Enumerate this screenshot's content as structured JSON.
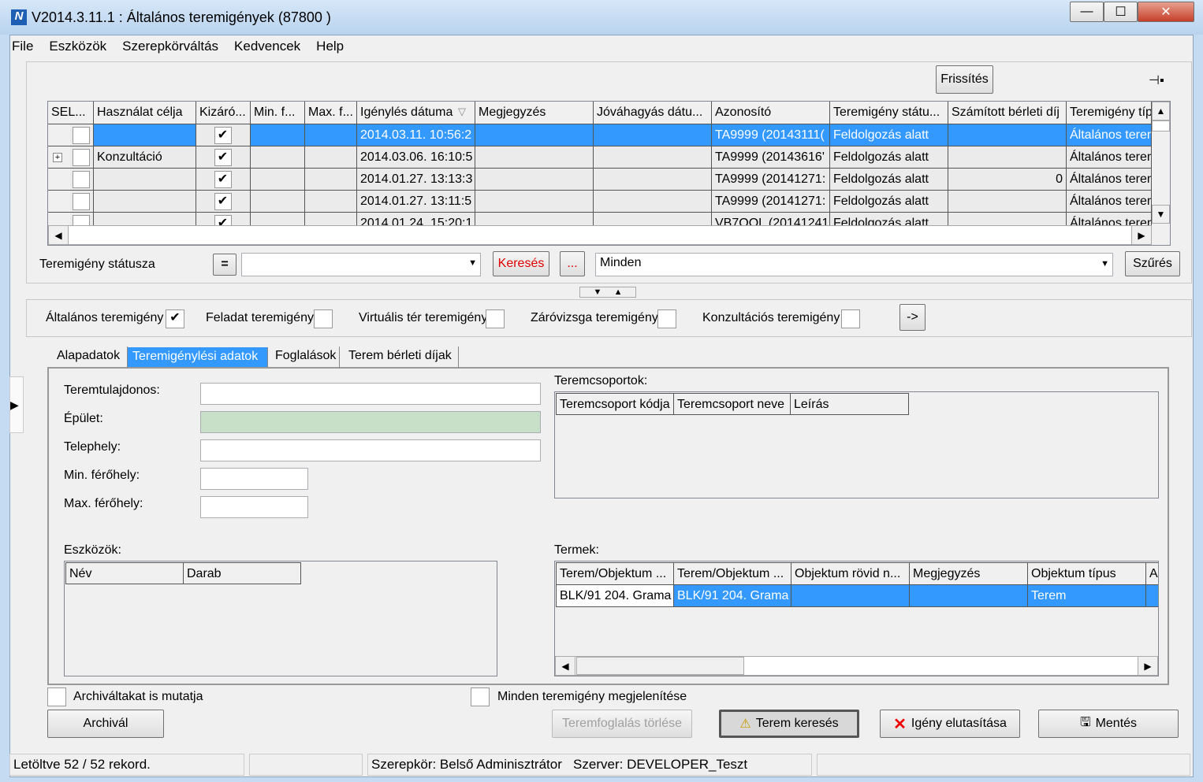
{
  "window": {
    "title": "V2014.3.11.1 : Általános teremigények (87800  )",
    "minimize": "—",
    "maximize": "☐",
    "close": "✕"
  },
  "menu": [
    "File",
    "Eszközök",
    "Szerepkörváltás",
    "Kedvencek",
    "Help"
  ],
  "toolbar": {
    "refresh": "Frissítés",
    "pin_icon": "pin-icon"
  },
  "main_grid": {
    "columns": [
      "SEL...",
      "Használat célja",
      "Kizáró...",
      "Min. f...",
      "Max. f...",
      "Igénylés dátuma",
      "Megjegyzés",
      "Jóváhagyás dátu...",
      "Azonosító",
      "Teremigény státu...",
      "Számított bérleti díj",
      "Teremigény típ"
    ],
    "sort_indicator": "▽",
    "rows": [
      {
        "selected": true,
        "expand": "",
        "sel": "",
        "cel": "",
        "kizaro": "✔",
        "min": "",
        "max": "",
        "datum": "2014.03.11. 10:56:2",
        "megj": "",
        "jovahagyas": "",
        "azon": "TA9999 (20143111(",
        "statusz": "Feldolgozás alatt",
        "dij": "",
        "tipus": "Általános terem"
      },
      {
        "selected": false,
        "expand": "+",
        "sel": "",
        "cel": "Konzultáció",
        "kizaro": "✔",
        "min": "",
        "max": "",
        "datum": "2014.03.06. 16:10:5",
        "megj": "",
        "jovahagyas": "",
        "azon": "TA9999 (20143616'",
        "statusz": "Feldolgozás alatt",
        "dij": "",
        "tipus": "Általános terem"
      },
      {
        "selected": false,
        "expand": "",
        "sel": "",
        "cel": "",
        "kizaro": "✔",
        "min": "",
        "max": "",
        "datum": "2014.01.27. 13:13:3",
        "megj": "",
        "jovahagyas": "",
        "azon": "TA9999 (20141271:",
        "statusz": "Feldolgozás alatt",
        "dij": "0",
        "tipus": "Általános terem"
      },
      {
        "selected": false,
        "expand": "",
        "sel": "",
        "cel": "",
        "kizaro": "✔",
        "min": "",
        "max": "",
        "datum": "2014.01.27. 13:11:5",
        "megj": "",
        "jovahagyas": "",
        "azon": "TA9999 (20141271:",
        "statusz": "Feldolgozás alatt",
        "dij": "",
        "tipus": "Általános terem"
      },
      {
        "selected": false,
        "expand": "",
        "sel": "",
        "cel": "",
        "kizaro": "✔",
        "min": "",
        "max": "",
        "datum": "2014.01.24. 15:20:1",
        "megj": "",
        "jovahagyas": "",
        "azon": "VB7OOL (20141241",
        "statusz": "Feldolgozás alatt",
        "dij": "",
        "tipus": "Általános terem"
      }
    ]
  },
  "filter": {
    "label": "Teremigény státusza",
    "equals": "=",
    "status_value": "",
    "search": "Keresés",
    "ellipsis": "...",
    "combo_value": "Minden",
    "filter_button": "Szűrés"
  },
  "types": [
    {
      "label": "Általános teremigény",
      "checked": true
    },
    {
      "label": "Feladat teremigény",
      "checked": false
    },
    {
      "label": "Virtuális tér teremigény",
      "checked": false
    },
    {
      "label": "Záróvizsga teremigény",
      "checked": false
    },
    {
      "label": "Konzultációs teremigény",
      "checked": false
    }
  ],
  "types_go": "->",
  "tabs": [
    {
      "label": "Alapadatok",
      "active": false
    },
    {
      "label": "Teremigénylési adatok",
      "active": true
    },
    {
      "label": "Foglalások",
      "active": false
    },
    {
      "label": "Terem bérleti díjak",
      "active": false
    }
  ],
  "form": {
    "teremtulajdonos": "Teremtulajdonos:",
    "epulet": "Épület:",
    "telephely": "Telephely:",
    "min": "Min. férőhely:",
    "max": "Max. férőhely:"
  },
  "teremcsoportok": {
    "label": "Teremcsoportok:",
    "columns": [
      "Teremcsoport kódja",
      "Teremcsoport neve",
      "Leírás"
    ]
  },
  "eszkozok": {
    "label": "Eszközök:",
    "columns": [
      "Név",
      "Darab"
    ]
  },
  "termek": {
    "label": "Termek:",
    "columns": [
      "Terem/Objektum ...",
      "Terem/Objektum ...",
      "Objektum rövid n...",
      "Megjegyzés",
      "Objektum típus",
      "A"
    ],
    "rows": [
      [
        "BLK/91 204. Grama",
        "BLK/91 204. Grama",
        "",
        "",
        "Terem",
        ""
      ]
    ]
  },
  "bottom": {
    "archived": "Archiváltakat is mutatja",
    "all": "Minden teremigény megjelenítése",
    "archive": "Archivál",
    "delete": "Teremfoglalás törlése",
    "room_search": "Terem keresés",
    "reject": "Igény elutasítása",
    "save": "Mentés"
  },
  "status": {
    "records": "Letöltve 52 / 52 rekord.",
    "role": "Szerepkör: Belső Adminisztrátor   Szerver: DEVELOPER_Teszt"
  },
  "colors": {
    "selection": "#3399ff",
    "building_field": "#c7e0c7",
    "search_text": "#e00000"
  }
}
